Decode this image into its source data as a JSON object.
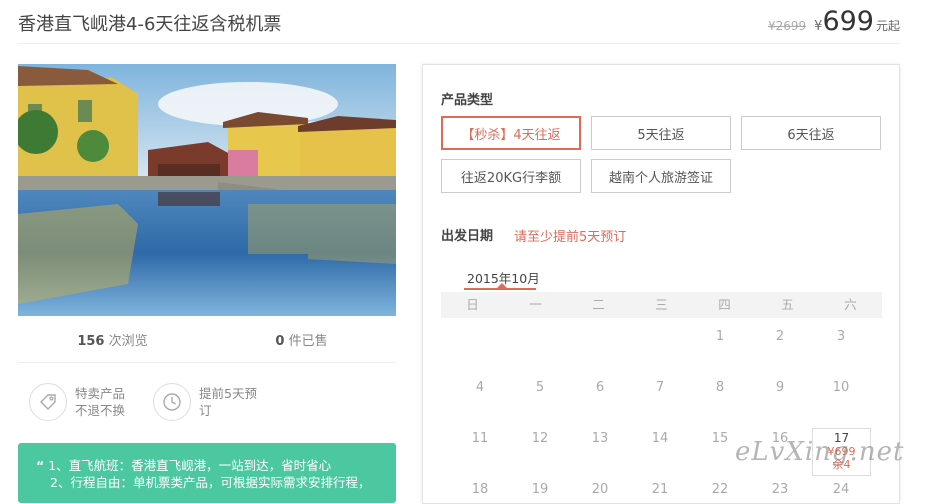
{
  "header": {
    "title": "香港直飞岘港4-6天往返含税机票",
    "old_price": "¥2699",
    "currency": "¥",
    "price": "699",
    "unit": "元起"
  },
  "stats": {
    "views_count": "156",
    "views_label": "次浏览",
    "sold_count": "0",
    "sold_label": "件已售"
  },
  "features": [
    {
      "line1": "特卖产品",
      "line2": "不退不换",
      "icon": "tag-icon"
    },
    {
      "line1": "提前5天预",
      "line2": "订",
      "icon": "clock-icon"
    }
  ],
  "highlights": {
    "quote": "“",
    "line1": "1、直飞航班：香港直飞岘港，一站到达，省时省心",
    "line2": "2、行程自由：单机票类产品，可根据实际需求安排行程，"
  },
  "product_type": {
    "title": "产品类型",
    "options": [
      "【秒杀】4天往返",
      "5天往返",
      "6天往返",
      "往返20KG行李额",
      "越南个人旅游签证"
    ]
  },
  "departure": {
    "title": "出发日期",
    "hint": "请至少提前5天预订",
    "month": "2015年10月",
    "weekdays": [
      "日",
      "一",
      "二",
      "三",
      "四",
      "五",
      "六"
    ],
    "days": [
      "1",
      "2",
      "3",
      "4",
      "5",
      "6",
      "7",
      "8",
      "9",
      "10",
      "11",
      "12",
      "13",
      "14",
      "15",
      "16",
      "17",
      "18",
      "19",
      "20",
      "21",
      "22",
      "23",
      "24"
    ],
    "selected_day": {
      "day": "17",
      "price": "¥699",
      "remain": "余4"
    }
  },
  "watermark": "eLvXing.net",
  "colors": {
    "accent": "#e06a55",
    "green": "#4cc8a0"
  }
}
